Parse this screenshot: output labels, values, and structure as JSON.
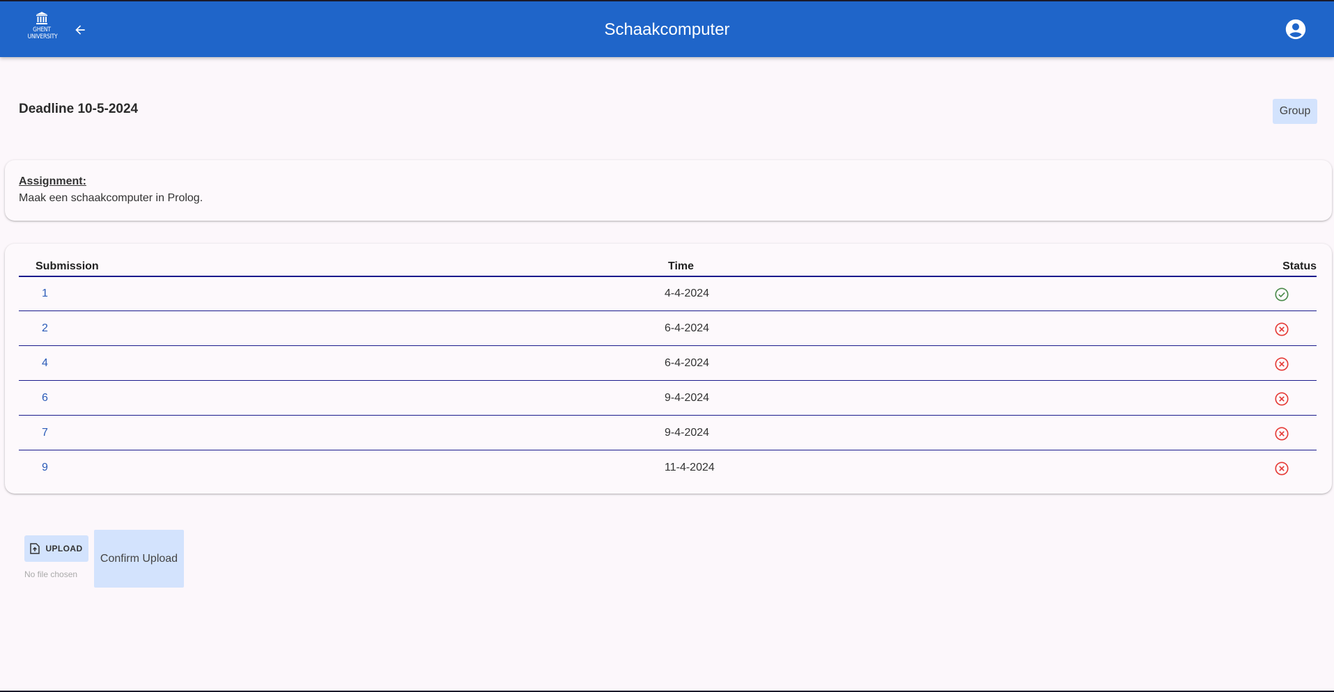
{
  "app": {
    "logo_line1": "GHENT",
    "logo_line2": "UNIVERSITY",
    "title": "Schaakcomputer"
  },
  "deadline": {
    "label": "Deadline",
    "value": "10-5-2024"
  },
  "group_button": "Group",
  "assignment": {
    "label": "Assignment:",
    "text": "Maak een schaakcomputer in Prolog."
  },
  "table": {
    "headers": {
      "submission": "Submission",
      "time": "Time",
      "status": "Status"
    },
    "rows": [
      {
        "submission": "1",
        "time": "4-4-2024",
        "status": "success"
      },
      {
        "submission": "2",
        "time": "6-4-2024",
        "status": "failed"
      },
      {
        "submission": "4",
        "time": "6-4-2024",
        "status": "failed"
      },
      {
        "submission": "6",
        "time": "9-4-2024",
        "status": "failed"
      },
      {
        "submission": "7",
        "time": "9-4-2024",
        "status": "failed"
      },
      {
        "submission": "9",
        "time": "11-4-2024",
        "status": "failed"
      }
    ]
  },
  "upload": {
    "button_label": "UPLOAD",
    "file_status": "No file chosen",
    "confirm_label": "Confirm Upload"
  },
  "colors": {
    "appbar": "#1f65c9",
    "success": "#4a8a4a",
    "failed": "#e53935",
    "button_bg": "#d3e3fd",
    "link": "#2a5bb8"
  }
}
